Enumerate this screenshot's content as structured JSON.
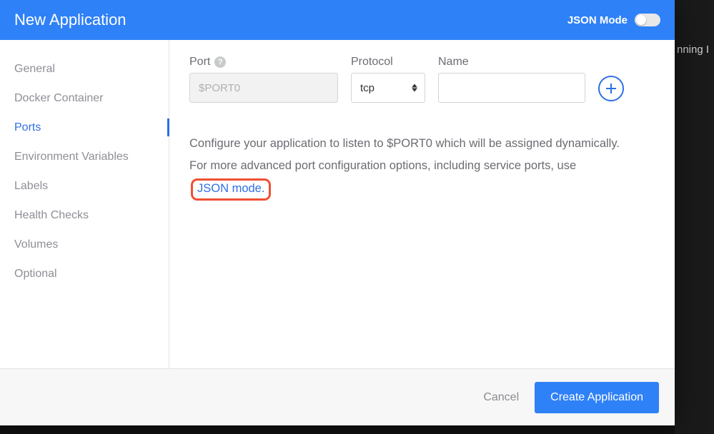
{
  "backdrop": {
    "text_fragment": "nning I"
  },
  "header": {
    "title": "New Application",
    "json_mode_label": "JSON Mode"
  },
  "sidebar": {
    "items": [
      {
        "label": "General",
        "active": false
      },
      {
        "label": "Docker Container",
        "active": false
      },
      {
        "label": "Ports",
        "active": true
      },
      {
        "label": "Environment Variables",
        "active": false
      },
      {
        "label": "Labels",
        "active": false
      },
      {
        "label": "Health Checks",
        "active": false
      },
      {
        "label": "Volumes",
        "active": false
      },
      {
        "label": "Optional",
        "active": false
      }
    ]
  },
  "form": {
    "port": {
      "label": "Port",
      "placeholder": "$PORT0",
      "value": ""
    },
    "protocol": {
      "label": "Protocol",
      "value": "tcp"
    },
    "name": {
      "label": "Name",
      "value": ""
    }
  },
  "help": {
    "line1": "Configure your application to listen to $PORT0 which will be assigned dynamically.",
    "line2_prefix": "For more advanced port configuration options, including service ports, use ",
    "link_text": "JSON mode."
  },
  "footer": {
    "cancel": "Cancel",
    "submit": "Create Application"
  }
}
